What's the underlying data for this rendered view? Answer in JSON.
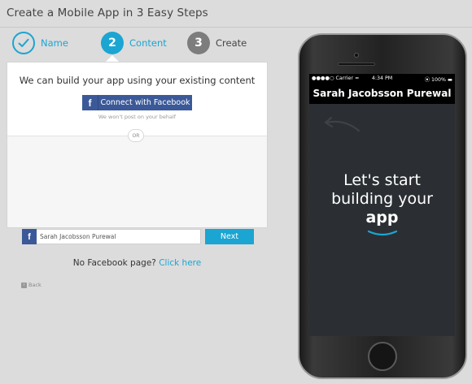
{
  "header": {
    "title": "Create a Mobile App in 3 Easy Steps"
  },
  "steps": [
    {
      "number": "",
      "label": "Name",
      "state": "done"
    },
    {
      "number": "2",
      "label": "Content",
      "state": "active"
    },
    {
      "number": "3",
      "label": "Create",
      "state": "pending"
    }
  ],
  "card": {
    "heading": "We can build your app using your existing content",
    "connect_button": {
      "icon": "f",
      "label": "Connect with Facebook"
    },
    "connect_note": "We won't post on your behalf",
    "or_label": "OR",
    "page_input": {
      "icon": "f",
      "value": "Sarah Jacobsson Purewal",
      "placeholder": ""
    },
    "next_button": "Next",
    "no_fb_text": "No Facebook page?",
    "no_fb_link": "Click here",
    "back_label": "Back"
  },
  "phone": {
    "status_left": "●●●●○ Carrier ≈",
    "status_time": "4:34 PM",
    "status_right": "⦿ 100% ▬",
    "app_title": "Sarah Jacobsson Purewal",
    "splash_line1": "Let's start",
    "splash_line2": "building your",
    "splash_bold": "app"
  },
  "colors": {
    "accent": "#1ba5d2",
    "facebook": "#3b5998",
    "pending": "#7d7d7d",
    "screen_bg": "#2b2f33"
  }
}
